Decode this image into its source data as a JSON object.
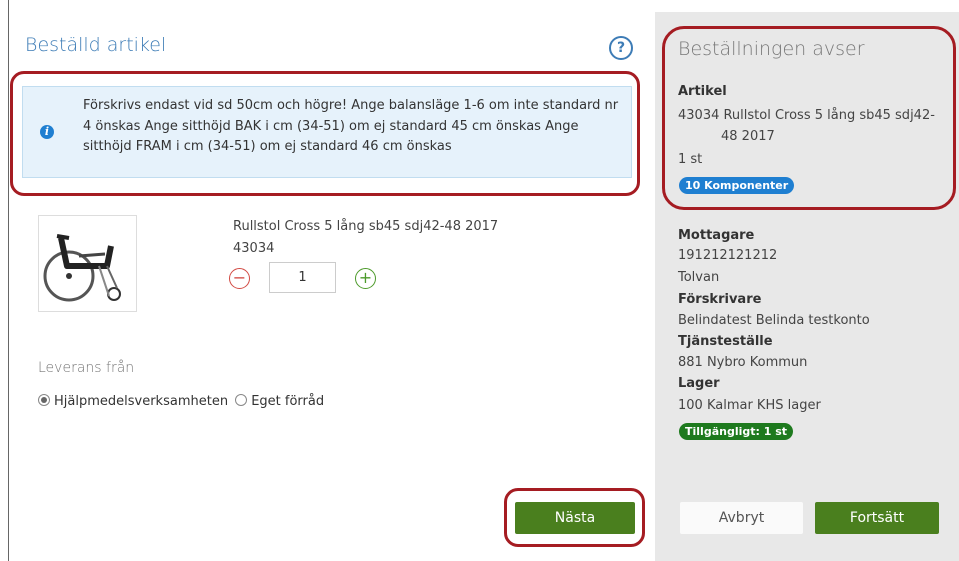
{
  "main": {
    "title": "Beställd artikel",
    "info_text": "Förskrivs endast vid sd 50cm och högre! Ange balansläge 1-6 om inte standard nr 4 önskas Ange sitthöjd BAK i cm (34-51) om ej standard 45 cm önskas Ange sitthöjd FRAM i cm (34-51) om ej standard 46 cm önskas",
    "product": {
      "name": "Rullstol Cross 5 lång sb45 sdj42-48 2017",
      "code": "43034",
      "quantity": "1",
      "minus": "−",
      "plus": "+",
      "image_icon": "wheelchair-image"
    },
    "delivery": {
      "label": "Leverans från",
      "options": [
        "Hjälpmedelsverksamheten",
        "Eget förråd"
      ],
      "selected": "Hjälpmedelsverksamheten"
    },
    "next_button": "Nästa"
  },
  "side": {
    "title": "Beställningen avser",
    "article_heading": "Artikel",
    "article_line1": "43034  Rullstol Cross 5 lång sb45 sdj42-",
    "article_line2": "48 2017",
    "article_qty": "1 st",
    "components_badge": "10 Komponenter",
    "recipient_heading": "Mottagare",
    "recipient_id": "191212121212",
    "recipient_name": "Tolvan",
    "prescriber_heading": "Förskrivare",
    "prescriber_name": "Belindatest Belinda testkonto",
    "unit_heading": "Tjänsteställe",
    "unit_name": "881 Nybro Kommun",
    "stock_heading": "Lager",
    "stock_name": "100 Kalmar KHS lager",
    "availability_badge": "Tillgängligt:  1 st",
    "cancel_button": "Avbryt",
    "continue_button": "Fortsätt"
  },
  "colors": {
    "accent_blue": "#3d7cb6",
    "button_green": "#4a7f1e",
    "highlight_red": "#a51c22",
    "badge_blue": "#1f7fd1",
    "badge_green": "#1e7a1e"
  }
}
